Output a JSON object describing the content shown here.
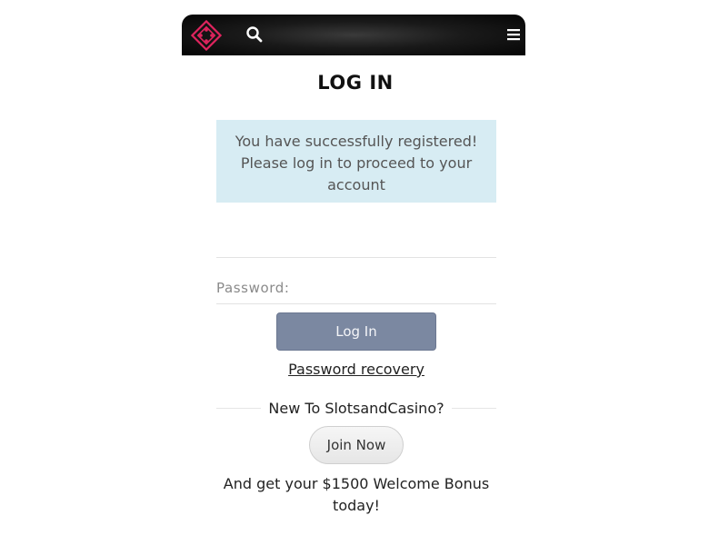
{
  "header": {
    "logo_icon": "diamond-logo-icon",
    "search_icon": "search-icon",
    "menu_icon": "hamburger-menu-icon",
    "logo_color": "#e0245e"
  },
  "page": {
    "title": "LOG IN"
  },
  "alert": {
    "message": "You have successfully registered! Please log in to proceed to your account",
    "background": "#d7ecf3"
  },
  "form": {
    "username_value": "",
    "password_placeholder": "Password:",
    "login_label": "Log In",
    "login_color": "#7b88a1",
    "recovery_label": "Password recovery"
  },
  "signup": {
    "prompt": "New To SlotsandCasino?",
    "join_label": "Join Now",
    "bonus_text": "And get your $1500 Welcome Bonus today!"
  }
}
